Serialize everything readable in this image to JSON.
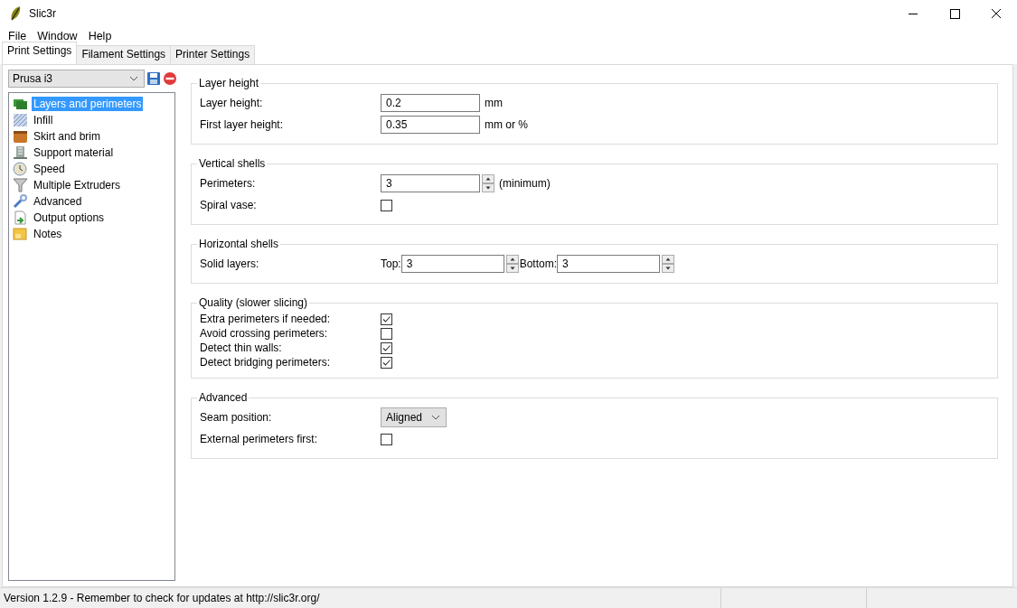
{
  "window": {
    "title": "Slic3r"
  },
  "menu": [
    "File",
    "Window",
    "Help"
  ],
  "tabs": [
    {
      "label": "Print Settings",
      "selected": true
    },
    {
      "label": "Filament Settings",
      "selected": false
    },
    {
      "label": "Printer Settings",
      "selected": false
    }
  ],
  "preset": {
    "value": "Prusa i3"
  },
  "sidebar": {
    "items": [
      {
        "label": "Layers and perimeters",
        "selected": true
      },
      {
        "label": "Infill",
        "selected": false
      },
      {
        "label": "Skirt and brim",
        "selected": false
      },
      {
        "label": "Support material",
        "selected": false
      },
      {
        "label": "Speed",
        "selected": false
      },
      {
        "label": "Multiple Extruders",
        "selected": false
      },
      {
        "label": "Advanced",
        "selected": false
      },
      {
        "label": "Output options",
        "selected": false
      },
      {
        "label": "Notes",
        "selected": false
      }
    ]
  },
  "groups": [
    {
      "title": "Layer height",
      "rows": [
        {
          "kind": "text",
          "label": "Layer height:",
          "value": "0.2",
          "unit": "mm"
        },
        {
          "kind": "text",
          "label": "First layer height:",
          "value": "0.35",
          "unit": "mm or %"
        }
      ]
    },
    {
      "title": "Vertical shells",
      "rows": [
        {
          "kind": "spin",
          "label": "Perimeters:",
          "value": "3",
          "unit": "(minimum)"
        },
        {
          "kind": "checkbox",
          "label": "Spiral vase:",
          "checked": false
        }
      ]
    },
    {
      "title": "Horizontal shells",
      "rows": [
        {
          "kind": "spins",
          "label": "Solid layers:",
          "fields": [
            {
              "label": "Top:",
              "value": "3"
            },
            {
              "label": "Bottom:",
              "value": "3"
            }
          ]
        }
      ]
    },
    {
      "title": "Quality (slower slicing)",
      "compact": true,
      "rows": [
        {
          "kind": "checkbox",
          "label": "Extra perimeters if needed:",
          "checked": true
        },
        {
          "kind": "checkbox",
          "label": "Avoid crossing perimeters:",
          "checked": false
        },
        {
          "kind": "checkbox",
          "label": "Detect thin walls:",
          "checked": true
        },
        {
          "kind": "checkbox",
          "label": "Detect bridging perimeters:",
          "checked": true
        }
      ]
    },
    {
      "title": "Advanced",
      "rows": [
        {
          "kind": "select",
          "label": "Seam position:",
          "value": "Aligned"
        },
        {
          "kind": "checkbox",
          "label": "External perimeters first:",
          "checked": false
        }
      ]
    }
  ],
  "status_bar": {
    "text": "Version 1.2.9 - Remember to check for updates at http://slic3r.org/"
  }
}
